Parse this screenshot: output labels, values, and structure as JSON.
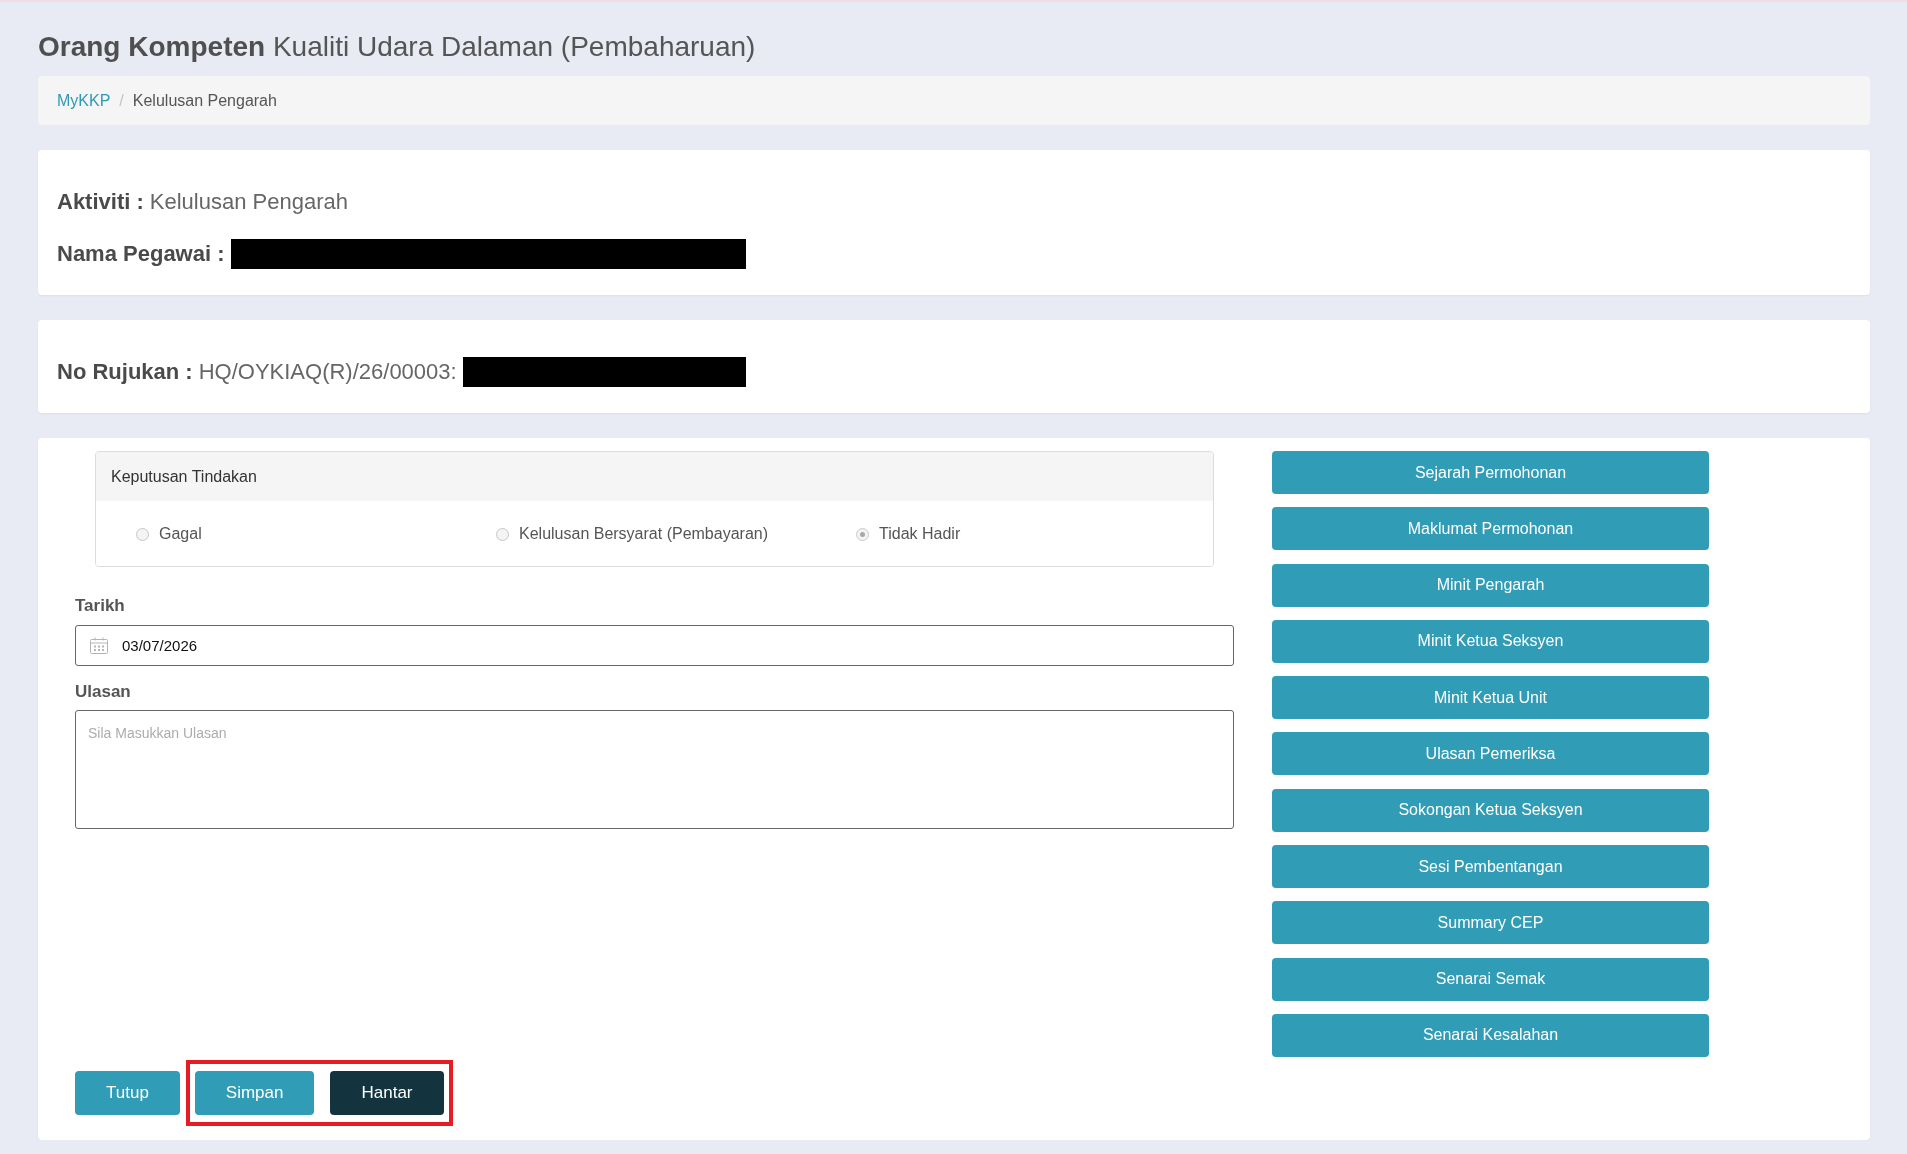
{
  "page_title": {
    "bold": "Orang Kompeten",
    "rest": "Kualiti Udara Dalaman (Pembaharuan)"
  },
  "breadcrumb": {
    "separator": "/",
    "items": [
      {
        "label": "MyKKP",
        "kind": "link"
      },
      {
        "label": "Kelulusan Pengarah",
        "kind": "current"
      }
    ]
  },
  "cards": [
    {
      "fields": [
        {
          "label": "Aktiviti :",
          "value": "Kelulusan Pengarah"
        },
        {
          "label": "Nama Pegawai :",
          "redacted": true
        }
      ]
    },
    {
      "fields": [
        {
          "label": "No Rujukan :",
          "value": "HQ/OYKIAQ(R)/26/00003:",
          "redacted": true
        }
      ]
    }
  ],
  "decision_panel": {
    "title": "Keputusan Tindakan",
    "options": [
      {
        "label": "Gagal",
        "selected": false
      },
      {
        "label": "Kelulusan Bersyarat (Pembayaran)",
        "selected": false
      },
      {
        "label": "Tidak Hadir",
        "selected": true
      }
    ]
  },
  "date_field": {
    "label": "Tarikh",
    "value": "03/07/2026"
  },
  "remarks_field": {
    "label": "Ulasan",
    "placeholder": "Sila Masukkan Ulasan"
  },
  "side_buttons": [
    "Sejarah Permohonan",
    "Maklumat Permohonan",
    "Minit Pengarah",
    "Minit Ketua Seksyen",
    "Minit Ketua Unit",
    "Ulasan Pemeriksa",
    "Sokongan Ketua Seksyen",
    "Sesi Pembentangan",
    "Summary CEP",
    "Senarai Semak",
    "Senarai Kesalahan"
  ],
  "actions": [
    {
      "label": "Tutup",
      "kind": "primary",
      "highlighted": false
    },
    {
      "label": "Simpan",
      "kind": "primary",
      "highlighted": true
    },
    {
      "label": "Hantar",
      "kind": "dark",
      "highlighted": true
    }
  ]
}
